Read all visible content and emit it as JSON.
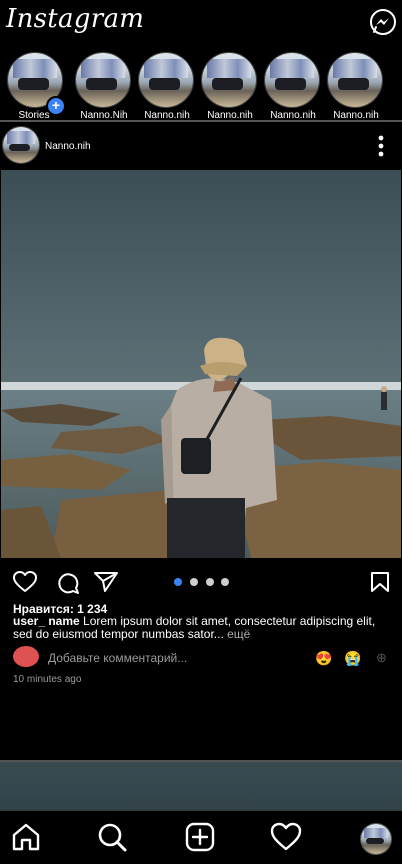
{
  "header": {
    "logo": "Instagram",
    "messenger_icon": "messenger-icon"
  },
  "stories": [
    {
      "label": "Stories",
      "own": true
    },
    {
      "label": "Nanno.Nih"
    },
    {
      "label": "Nanno.nih"
    },
    {
      "label": "Nanno.nih"
    },
    {
      "label": "Nanno.nih"
    },
    {
      "label": "Nanno.nih"
    }
  ],
  "post": {
    "username": "Nanno.nih",
    "likes": "Нравится: 1 234",
    "caption_user": "user_ name",
    "caption_text": " Lorem ipsum dolor sit amet, consectetur adipiscing elit, sed do eiusmod tempor numbas sator...",
    "caption_more": " ещё",
    "comment_placeholder": "Добавьте комментарий...",
    "emojis": [
      "😍",
      "😭"
    ],
    "add_emoji_icon": "⊕",
    "time": "10 minutes ago",
    "carousel_dots": 4,
    "carousel_active": 0
  },
  "colors": {
    "background": "#000000",
    "accent": "#3b82f6",
    "comment_avatar": "#e05252",
    "muted_text": "#9a9a9a"
  },
  "bottom_nav": [
    "home-icon",
    "search-icon",
    "add-post-icon",
    "heart-icon",
    "profile-avatar"
  ]
}
